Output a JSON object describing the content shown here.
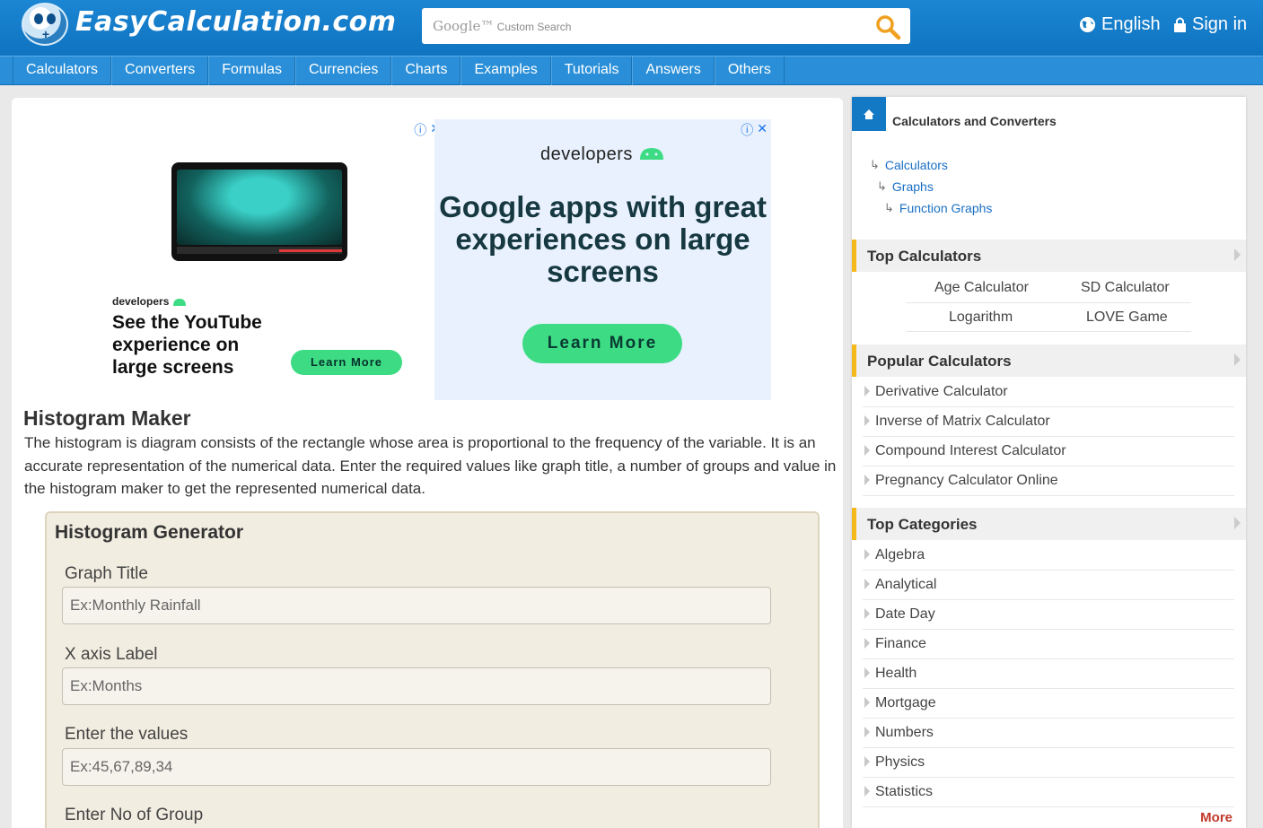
{
  "header": {
    "logo_text": "EasyCalculation.com",
    "search_brand": "Google™",
    "search_placeholder": "Custom Search",
    "language": "English",
    "signin": "Sign in"
  },
  "nav": {
    "items": [
      "Calculators",
      "Converters",
      "Formulas",
      "Currencies",
      "Charts",
      "Examples",
      "Tutorials",
      "Answers",
      "Others"
    ]
  },
  "ads": {
    "ad1": {
      "brand": "developers",
      "title": "See the YouTube experience on large screens",
      "cta": "Learn More"
    },
    "ad2": {
      "brand": "developers",
      "headline": "Google apps with great experiences on large screens",
      "cta": "Learn More"
    },
    "info_icon": "ⓘ",
    "close_icon": "✕"
  },
  "main": {
    "title": "Histogram Maker",
    "description": "The histogram is diagram consists of the rectangle whose area is proportional to the frequency of the variable. It is an accurate representation of the numerical data. Enter the required values like graph title, a number of groups and value in the histogram maker to get the represented numerical data."
  },
  "generator": {
    "title": "Histogram Generator",
    "fields": [
      {
        "label": "Graph Title",
        "placeholder": "Ex:Monthly Rainfall",
        "value": ""
      },
      {
        "label": "X axis Label",
        "placeholder": "Ex:Months",
        "value": ""
      },
      {
        "label": "Enter the values",
        "placeholder": "Ex:45,67,89,34",
        "value": ""
      },
      {
        "label": "Enter No of Group",
        "placeholder": "",
        "value": ""
      }
    ]
  },
  "sidebar": {
    "heading": "Calculators and Converters",
    "breadcrumb": [
      "Calculators",
      "Graphs",
      "Function Graphs"
    ],
    "top_calculators": {
      "title": "Top Calculators",
      "items": [
        "Age Calculator",
        "SD Calculator",
        "Logarithm",
        "LOVE Game"
      ]
    },
    "popular_calculators": {
      "title": "Popular Calculators",
      "items": [
        "Derivative Calculator",
        "Inverse of Matrix Calculator",
        "Compound Interest Calculator",
        "Pregnancy Calculator Online"
      ]
    },
    "top_categories": {
      "title": "Top Categories",
      "items": [
        "Algebra",
        "Analytical",
        "Date Day",
        "Finance",
        "Health",
        "Mortgage",
        "Numbers",
        "Physics",
        "Statistics"
      ]
    },
    "more": "More"
  },
  "colors": {
    "header_blue": "#1479c4",
    "nav_blue": "#2a8fd8",
    "accent_yellow": "#f5b91c",
    "cta_green": "#3ddc84",
    "more_red": "#c0392b"
  }
}
